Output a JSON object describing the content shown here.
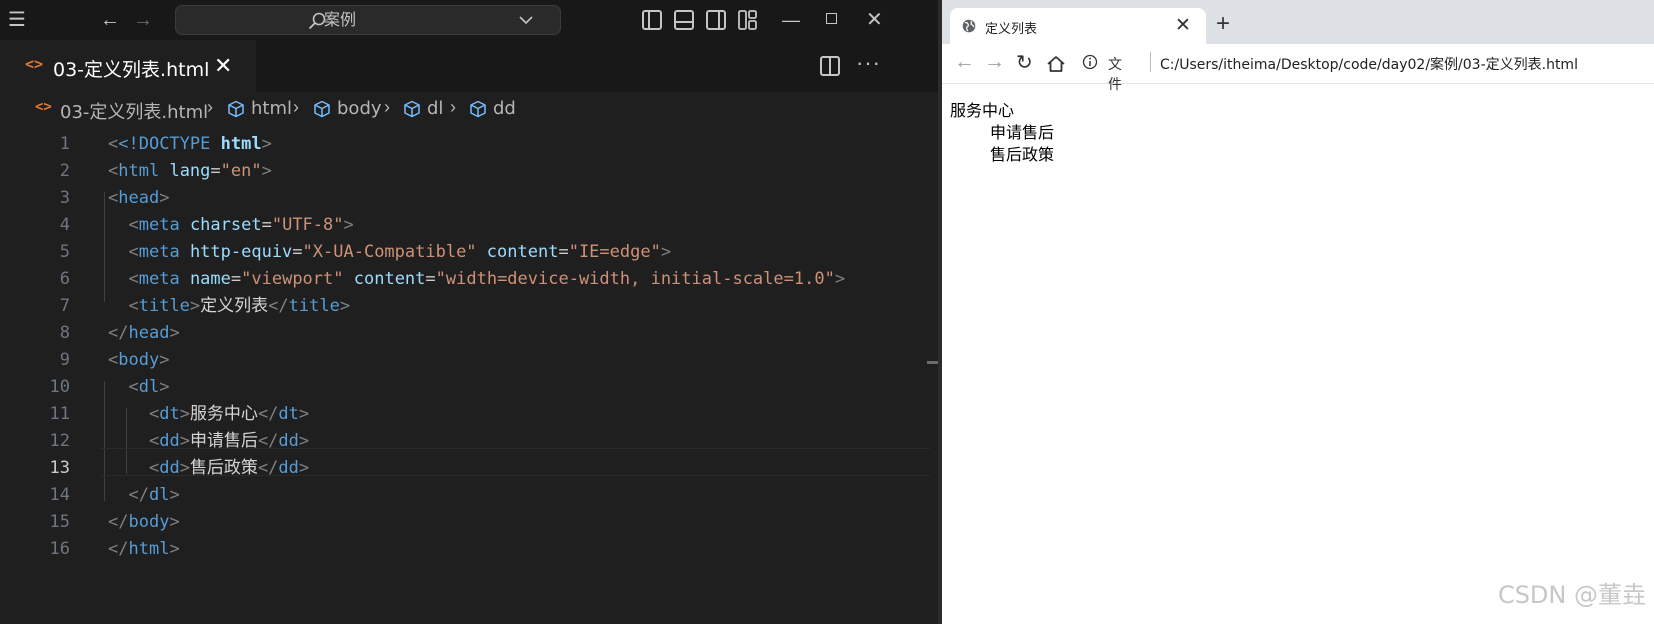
{
  "editor": {
    "search_label": "案例",
    "tab_name": "03-定义列表.html",
    "breadcrumb": [
      "03-定义列表.html",
      "html",
      "body",
      "dl",
      "dd"
    ],
    "current_line": 13,
    "lines": [
      {
        "n": "1"
      },
      {
        "n": "2"
      },
      {
        "n": "3"
      },
      {
        "n": "4"
      },
      {
        "n": "5"
      },
      {
        "n": "6"
      },
      {
        "n": "7"
      },
      {
        "n": "8"
      },
      {
        "n": "9"
      },
      {
        "n": "10"
      },
      {
        "n": "11"
      },
      {
        "n": "12"
      },
      {
        "n": "13"
      },
      {
        "n": "14"
      },
      {
        "n": "15"
      },
      {
        "n": "16"
      }
    ],
    "code": {
      "l1_doc": "<!DOCTYPE",
      "l1_html": " html",
      "l2_lang_val": "\"en\"",
      "l4_charset_val": "\"UTF-8\"",
      "l5_equiv_val": "\"X-UA-Compatible\"",
      "l5_content_val": "\"IE=edge\"",
      "l6_name_val": "\"viewport\"",
      "l6_content_val": "\"width=device-width, initial-scale=1.0\"",
      "l7_title_text": "定义列表",
      "l11_text": "服务中心",
      "l12_text": "申请售后",
      "l13_text": "售后政策"
    }
  },
  "browser": {
    "tab_title": "定义列表",
    "file_label": "文件",
    "url": "C:/Users/itheima/Desktop/code/day02/案例/03-定义列表.html",
    "dt": "服务中心",
    "dd": [
      "申请售后",
      "售后政策"
    ]
  },
  "watermark": "CSDN @董垚"
}
